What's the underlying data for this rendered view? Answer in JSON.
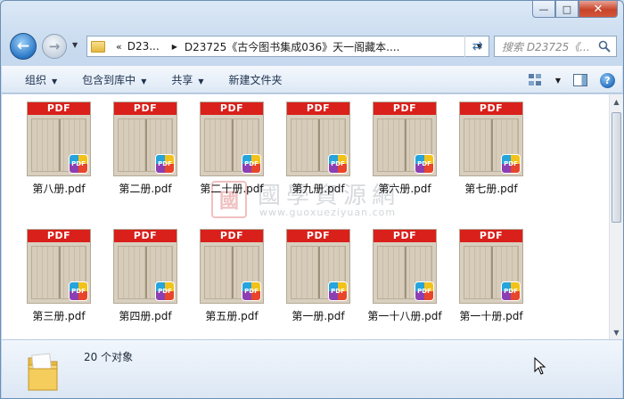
{
  "window": {
    "caption_buttons": [
      "—",
      "□",
      "✕"
    ]
  },
  "nav": {
    "back_icon": "back-arrow-icon",
    "forward_icon": "forward-arrow-icon",
    "address_chevron": "«",
    "address_segments": [
      "D23...",
      "D23725《古今图书集成036》天一阁藏本...."
    ],
    "search_placeholder": "搜索 D23725《..."
  },
  "toolbar": {
    "organize": "组织",
    "include_library": "包含到库中",
    "share": "共享",
    "new_folder": "新建文件夹"
  },
  "files": [
    {
      "name": "第八册.pdf"
    },
    {
      "name": "第二册.pdf"
    },
    {
      "name": "第二十册.pdf"
    },
    {
      "name": "第九册.pdf"
    },
    {
      "name": "第六册.pdf"
    },
    {
      "name": "第七册.pdf"
    },
    {
      "name": "第三册.pdf"
    },
    {
      "name": "第四册.pdf"
    },
    {
      "name": "第五册.pdf"
    },
    {
      "name": "第一册.pdf"
    },
    {
      "name": "第一十八册.pdf"
    },
    {
      "name": "第一十册.pdf"
    }
  ],
  "thumb_band_label": "PDF",
  "badge_label": "PDF",
  "watermark": {
    "seal": "國",
    "title": "國學資源網",
    "url": "www.guoxueziyuan.com"
  },
  "status": {
    "count_text": "20 个对象"
  },
  "colors": {
    "pdf_band": "#d9201b",
    "window_frame": "#c6d9ee",
    "close_button": "#c8442b"
  }
}
